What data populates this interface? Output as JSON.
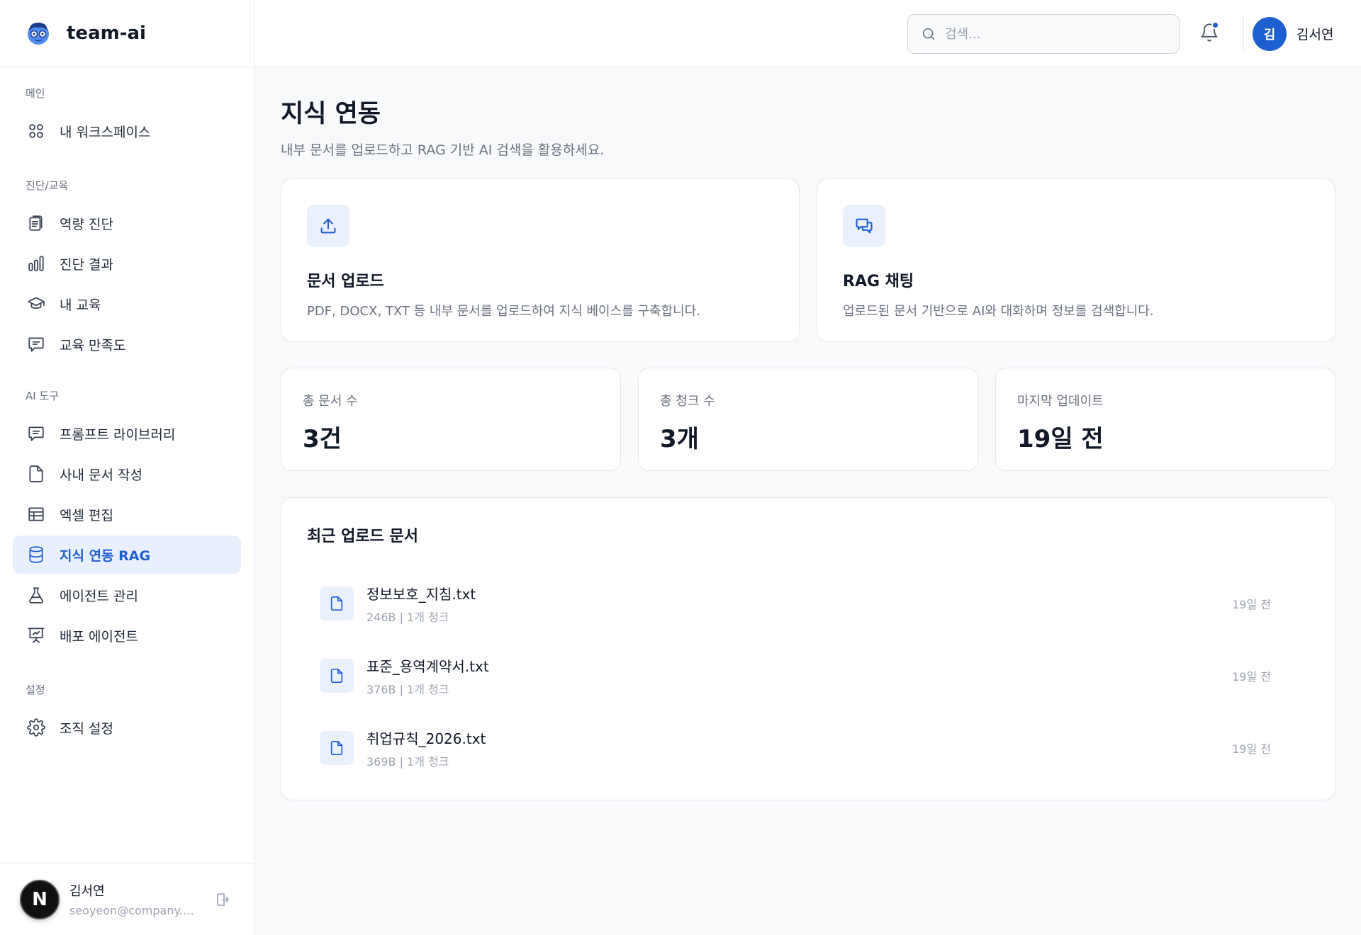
{
  "brand": {
    "name": "team-ai",
    "logo_icon": "robot-face-icon"
  },
  "sidebar": {
    "sections": [
      {
        "title": "메인",
        "items": [
          {
            "label": "내 워크스페이스",
            "icon": "grid-icon"
          }
        ]
      },
      {
        "title": "진단/교육",
        "items": [
          {
            "label": "역량 진단",
            "icon": "clipboard-icon"
          },
          {
            "label": "진단 결과",
            "icon": "bar-chart-icon"
          },
          {
            "label": "내 교육",
            "icon": "graduation-cap-icon"
          },
          {
            "label": "교육 만족도",
            "icon": "message-square-icon"
          }
        ]
      },
      {
        "title": "AI 도구",
        "items": [
          {
            "label": "프롬프트 라이브러리",
            "icon": "message-square-text-icon"
          },
          {
            "label": "사내 문서 작성",
            "icon": "file-icon"
          },
          {
            "label": "엑셀 편집",
            "icon": "table-icon"
          },
          {
            "label": "지식 연동 RAG",
            "icon": "database-icon",
            "active": true
          },
          {
            "label": "에이전트 관리",
            "icon": "flask-icon"
          },
          {
            "label": "배포 에이전트",
            "icon": "presentation-icon"
          }
        ]
      },
      {
        "title": "설정",
        "items": [
          {
            "label": "조직 설정",
            "icon": "gear-icon"
          }
        ]
      }
    ],
    "user": {
      "avatar_letter": "N",
      "name": "김서연",
      "email": "seoyeon@company.com"
    }
  },
  "topbar": {
    "search_placeholder": "검색...",
    "avatar_letter": "김",
    "user_name": "김서연",
    "accent_color": "#1d5fd1"
  },
  "page": {
    "title": "지식 연동",
    "subtitle": "내부 문서를 업로드하고 RAG 기반 AI 검색을 활용하세요."
  },
  "features": [
    {
      "title": "문서 업로드",
      "desc": "PDF, DOCX, TXT 등 내부 문서를 업로드하여 지식 베이스를 구축합니다.",
      "icon": "upload-icon"
    },
    {
      "title": "RAG 채팅",
      "desc": "업로드된 문서 기반으로 AI와 대화하며 정보를 검색합니다.",
      "icon": "chat-bubbles-icon"
    }
  ],
  "stats": [
    {
      "label": "총 문서 수",
      "value": "3건"
    },
    {
      "label": "총 청크 수",
      "value": "3개"
    },
    {
      "label": "마지막 업데이트",
      "value": "19일 전"
    }
  ],
  "recent": {
    "title": "최근 업로드 문서",
    "docs": [
      {
        "name": "정보보호_지침.txt",
        "meta": "246B | 1개 청크",
        "time": "19일 전"
      },
      {
        "name": "표준_용역계약서.txt",
        "meta": "376B | 1개 청크",
        "time": "19일 전"
      },
      {
        "name": "취업규칙_2026.txt",
        "meta": "369B | 1개 청크",
        "time": "19일 전"
      }
    ]
  }
}
